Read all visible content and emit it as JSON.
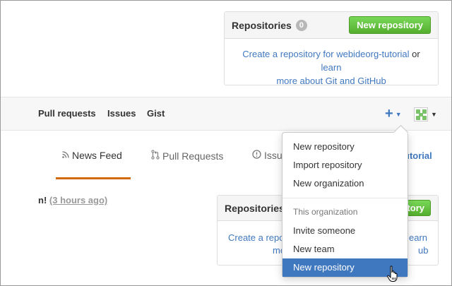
{
  "top_repos": {
    "title": "Repositories",
    "count": "0",
    "new_button": "New repository",
    "body_link1": "Create a repository for webideorg-tutorial",
    "body_or": " or ",
    "body_link2a": "learn",
    "body_link2b": "more about Git and GitHub"
  },
  "nav": {
    "pull_requests": "Pull requests",
    "issues": "Issues",
    "gist": "Gist",
    "plus": "+"
  },
  "tabs": {
    "news_feed": "News Feed",
    "pull_requests": "Pull Requests",
    "issues_partial": "Issu",
    "tutorial_partial": "utorial"
  },
  "feed": {
    "prefix": "n!",
    "time": "(3 hours ago)"
  },
  "bottom_repos": {
    "title": "Repositories",
    "new_button": "itory",
    "left1": "Create a repo",
    "left2": "mo",
    "right1": "earn",
    "right2": "ub"
  },
  "dropdown": {
    "items_top": [
      "New repository",
      "Import repository",
      "New organization"
    ],
    "section_header": "This organization",
    "items_org": [
      "Invite someone",
      "New team",
      "New repository"
    ]
  },
  "colors": {
    "accent": "#4078c0",
    "green": "#6cc644",
    "tab_underline": "#d26911"
  }
}
